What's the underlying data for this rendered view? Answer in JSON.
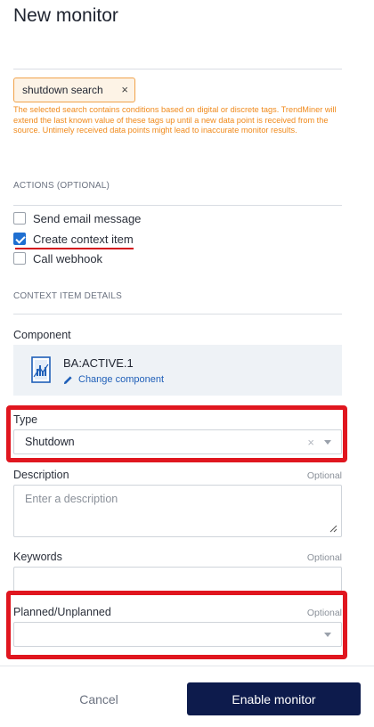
{
  "header": {
    "title": "New monitor"
  },
  "search_chip": {
    "label": "shutdown search",
    "remove_glyph": "×"
  },
  "warning_text": "The selected search contains conditions based on digital or discrete tags. TrendMiner will extend the last known value of these tags up until a new data point is received from the source. Untimely received data points might lead to inaccurate monitor results.",
  "actions": {
    "section_label": "ACTIONS (OPTIONAL)",
    "items": [
      {
        "label": "Send email message",
        "checked": false
      },
      {
        "label": "Create context item",
        "checked": true
      },
      {
        "label": "Call webhook",
        "checked": false
      }
    ]
  },
  "context_item": {
    "section_label": "CONTEXT ITEM DETAILS",
    "component": {
      "label": "Component",
      "name": "BA:ACTIVE.1",
      "change_label": "Change component",
      "icon": "asset-document-icon"
    },
    "type": {
      "label": "Type",
      "value": "Shutdown",
      "clear_glyph": "×"
    },
    "description": {
      "label": "Description",
      "optional_label": "Optional",
      "placeholder": "Enter a description"
    },
    "keywords": {
      "label": "Keywords",
      "optional_label": "Optional"
    },
    "planned": {
      "label": "Planned/Unplanned",
      "optional_label": "Optional",
      "value": ""
    }
  },
  "footer": {
    "cancel_label": "Cancel",
    "enable_label": "Enable monitor"
  },
  "colors": {
    "warning": "#f08a1c",
    "highlight": "#e0161f",
    "primary_button": "#0d1b4c",
    "link": "#1f5fb8",
    "checkbox": "#1f6fd1"
  }
}
